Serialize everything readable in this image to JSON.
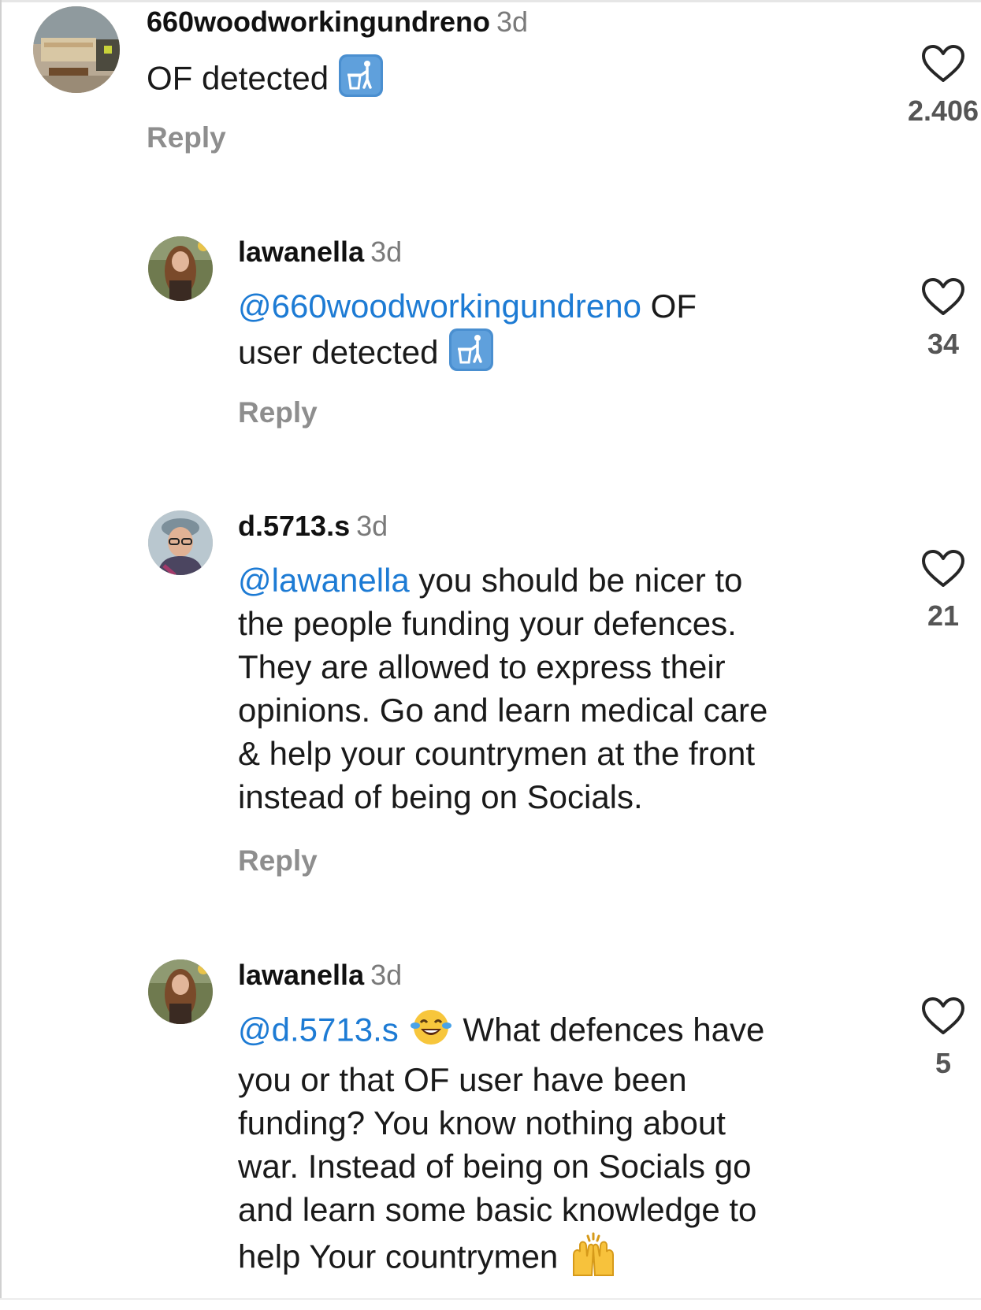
{
  "comments": [
    {
      "username": "660woodworkingundreno",
      "time": "3d",
      "text": "OF detected",
      "emoji": "litter-in-bin-icon",
      "reply_label": "Reply",
      "likes": "2.406"
    },
    {
      "username": "lawanella",
      "time": "3d",
      "mention": "@660woodworkingundreno",
      "text_line1": " OF",
      "text_line2": "user detected",
      "emoji": "litter-in-bin-icon",
      "reply_label": "Reply",
      "likes": "34"
    },
    {
      "username": "d.5713.s",
      "time": "3d",
      "mention": "@lawanella",
      "line1": " you should be nicer to",
      "line2": "the people funding your defences.",
      "line3": "They are allowed to express their",
      "line4": "opinions. Go and learn medical care",
      "line5": "& help your countrymen at the front",
      "line6": "instead of being on Socials.",
      "reply_label": "Reply",
      "likes": "21"
    },
    {
      "username": "lawanella",
      "time": "3d",
      "mention": "@d.5713.s",
      "emoji1": "face-with-tears-of-joy-icon",
      "line1": " What defences have",
      "line2": "you or that OF user have been",
      "line3": "funding? You know nothing about",
      "line4": "war. Instead of being on Socials go",
      "line5": "and learn some basic knowledge to",
      "line6": "help Your countrymen",
      "emoji2": "raising-hands-icon",
      "likes": "5"
    }
  ],
  "colors": {
    "mention": "#1d7bd4",
    "username": "#111111",
    "muted": "#8e8e8e"
  }
}
